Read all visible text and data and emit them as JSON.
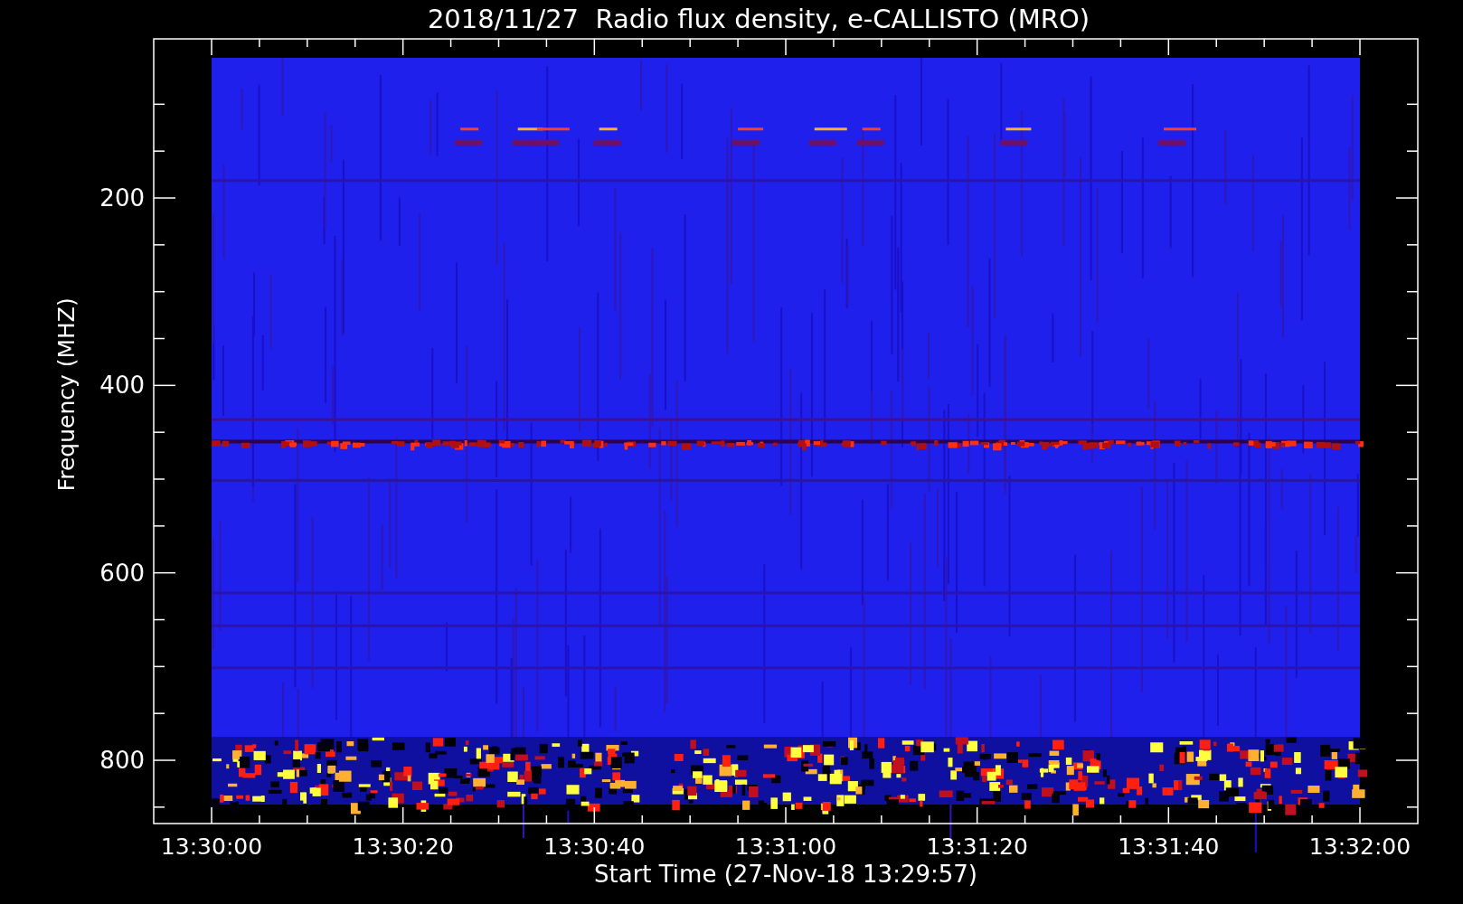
{
  "title": "2018/11/27  Radio flux density, e-CALLISTO (MRO)",
  "y_axis": {
    "label": "Frequency (MHZ)",
    "ticks": [
      "200",
      "400",
      "600",
      "800"
    ]
  },
  "x_axis": {
    "label": "Start Time (27-Nov-18 13:29:57)",
    "ticks": [
      "13:30:00",
      "13:30:20",
      "13:30:40",
      "13:31:00",
      "13:31:20",
      "13:31:40",
      "13:32:00"
    ]
  }
}
